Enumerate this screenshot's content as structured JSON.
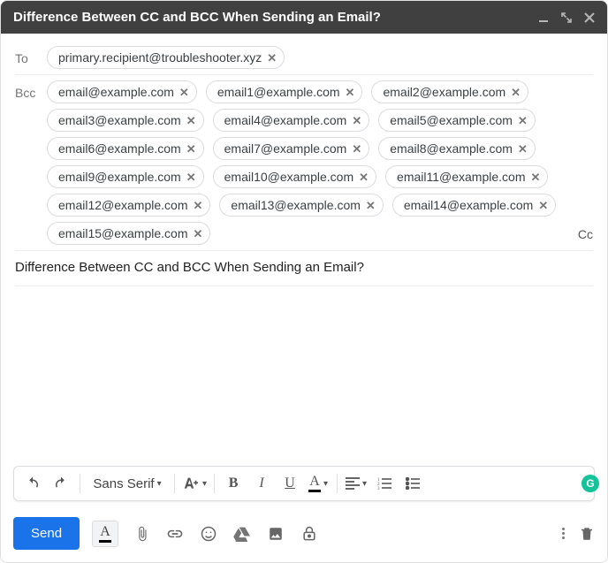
{
  "titlebar": {
    "title": "Difference Between CC and BCC When Sending an Email?"
  },
  "fields": {
    "to_label": "To",
    "bcc_label": "Bcc",
    "cc_link": "Cc"
  },
  "to_recipients": [
    "primary.recipient@troubleshooter.xyz"
  ],
  "bcc_recipients": [
    "email@example.com",
    "email1@example.com",
    "email2@example.com",
    "email3@example.com",
    "email4@example.com",
    "email5@example.com",
    "email6@example.com",
    "email7@example.com",
    "email8@example.com",
    "email9@example.com",
    "email10@example.com",
    "email11@example.com",
    "email12@example.com",
    "email13@example.com",
    "email14@example.com",
    "email15@example.com"
  ],
  "subject": "Difference Between CC and BCC When Sending an Email?",
  "format_toolbar": {
    "font_name": "Sans Serif",
    "bold": "B",
    "italic": "I",
    "underline": "U",
    "text_color": "A"
  },
  "bottom": {
    "send": "Send",
    "text_format_a": "A"
  },
  "grammarly_glyph": "G"
}
